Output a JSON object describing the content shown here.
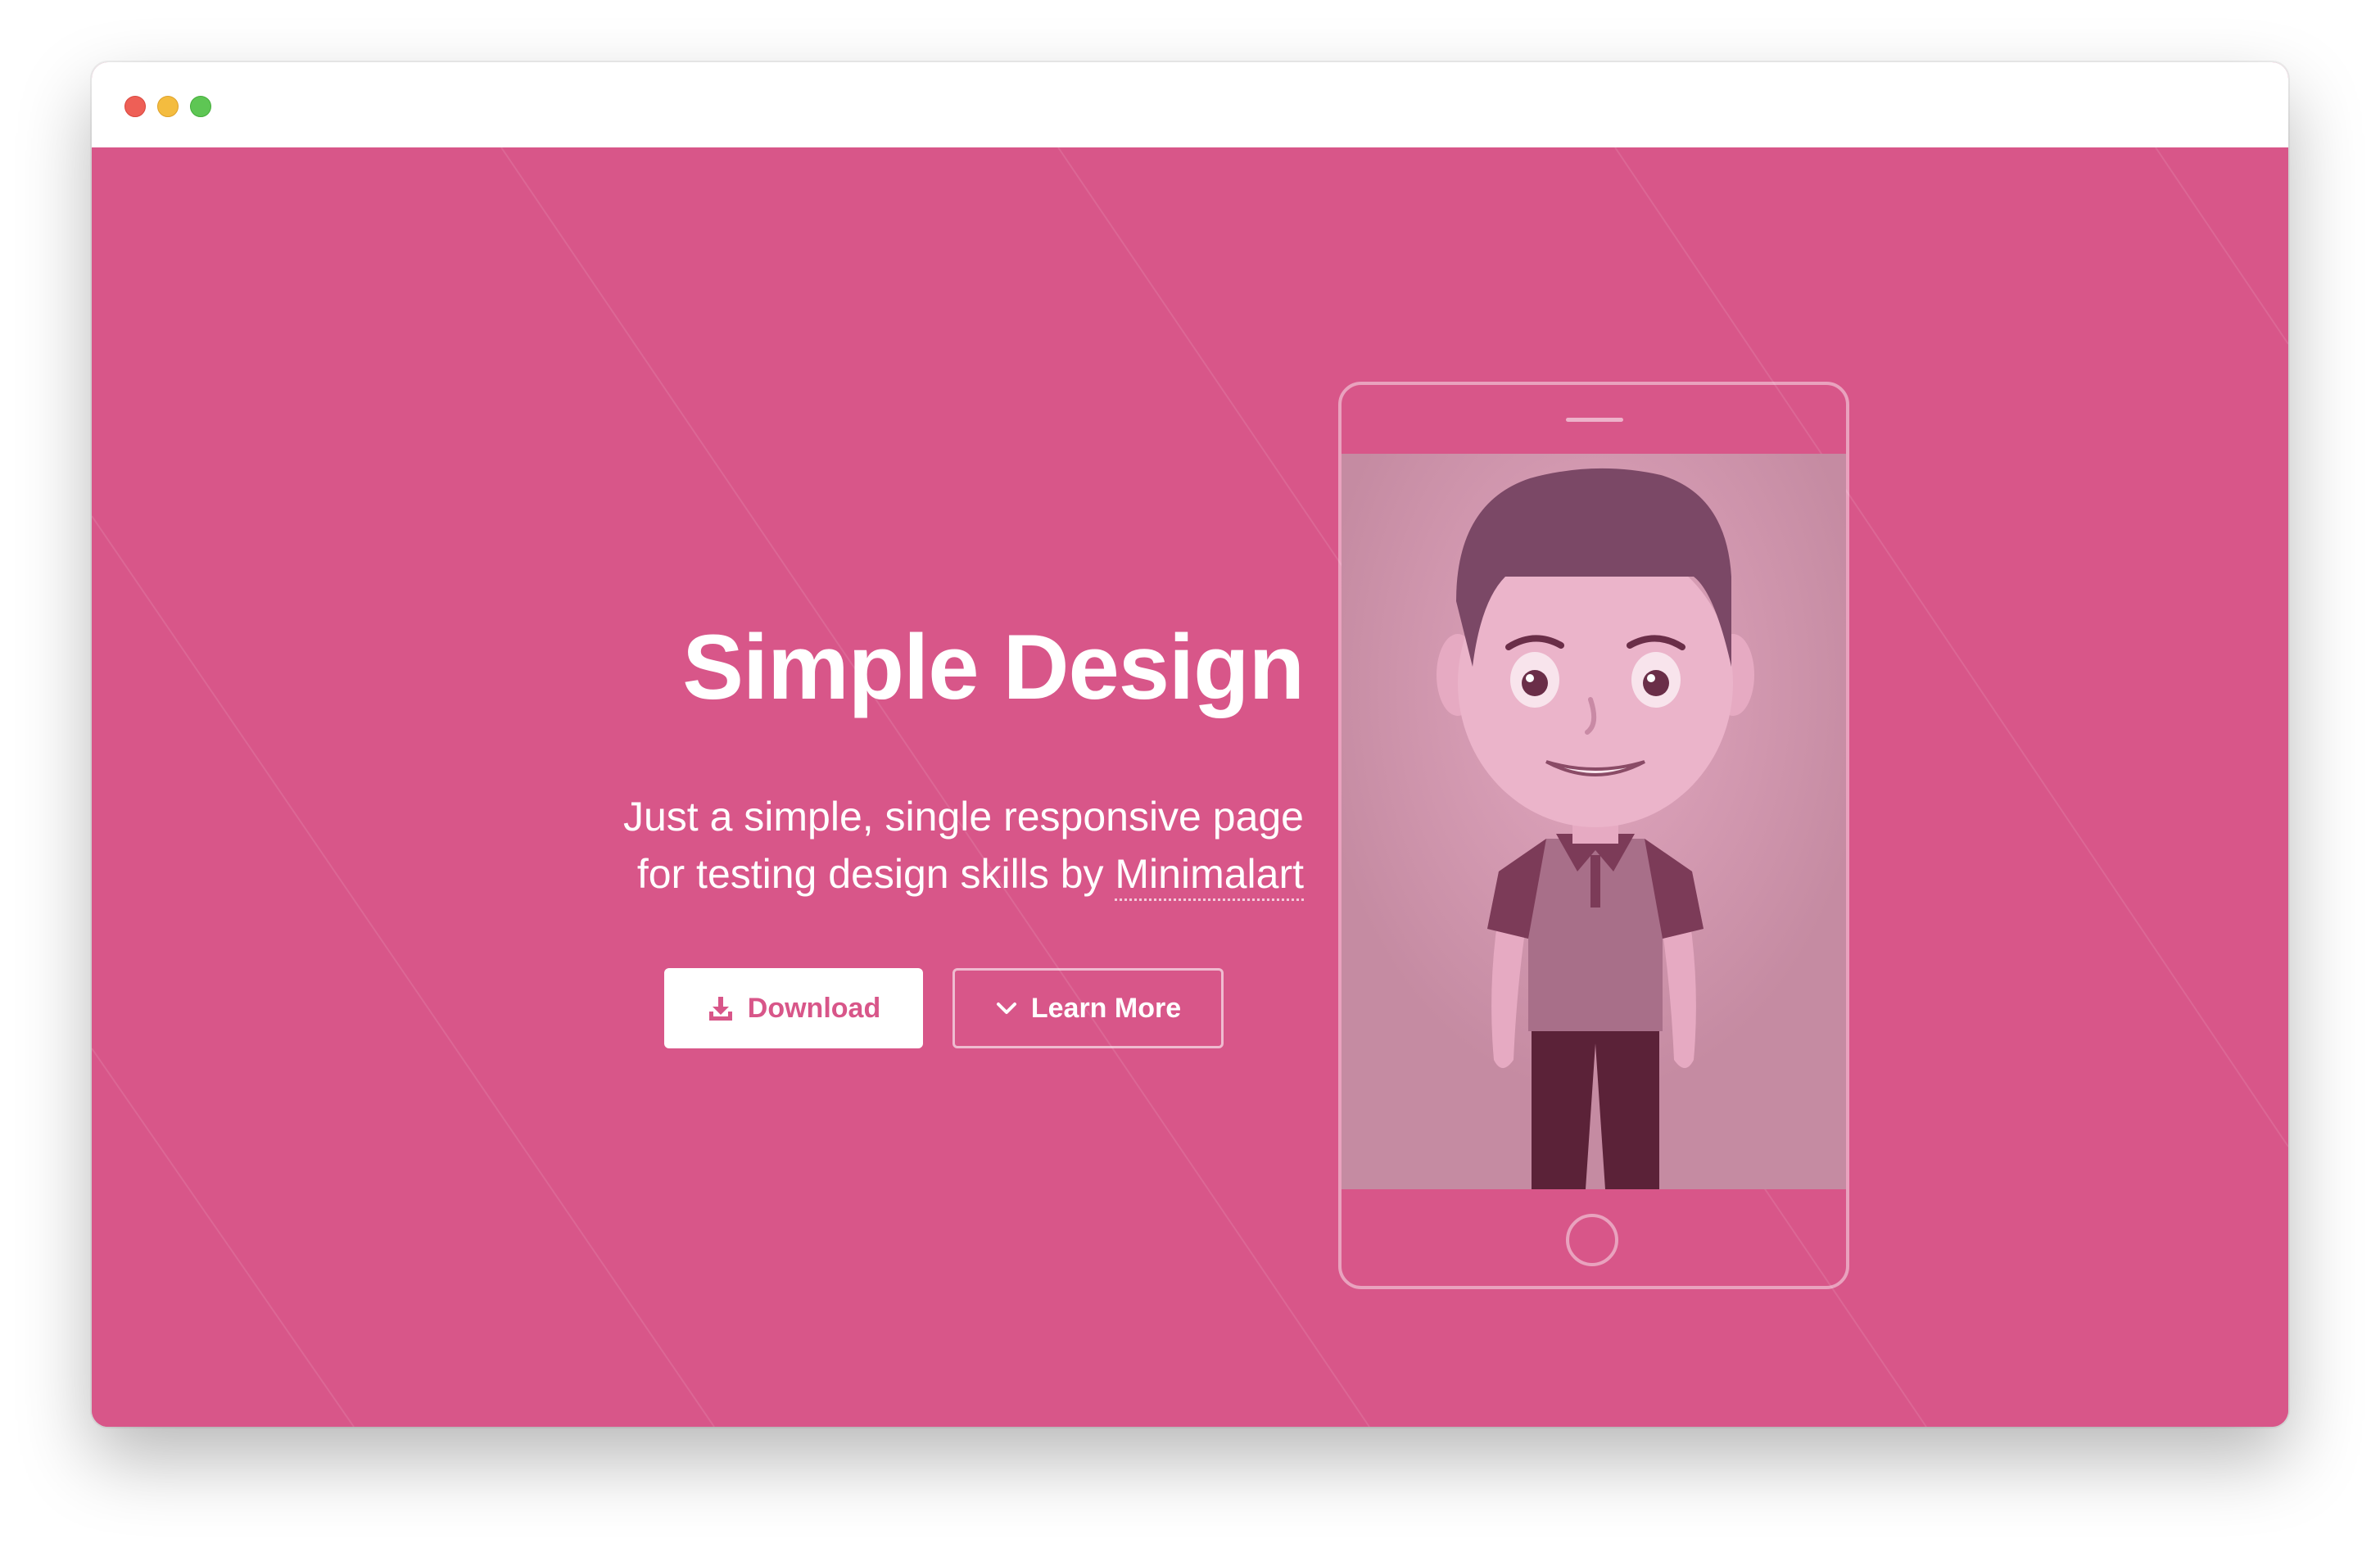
{
  "window": {
    "traffic_lights": [
      "close",
      "minimize",
      "zoom"
    ]
  },
  "hero": {
    "title": "Simple Design",
    "subtitle_line1": "Just a simple, single responsive page",
    "subtitle_line2_prefix": "for testing design skills by ",
    "subtitle_link": "Minimalart",
    "download_label": "Download",
    "learn_more_label": "Learn More"
  },
  "icons": {
    "download": "download-icon",
    "learn_more": "chevron-down-icon"
  },
  "colors": {
    "background": "#d85689",
    "screen": "#c58ba2",
    "button_text": "#d85689",
    "white": "#ffffff"
  }
}
